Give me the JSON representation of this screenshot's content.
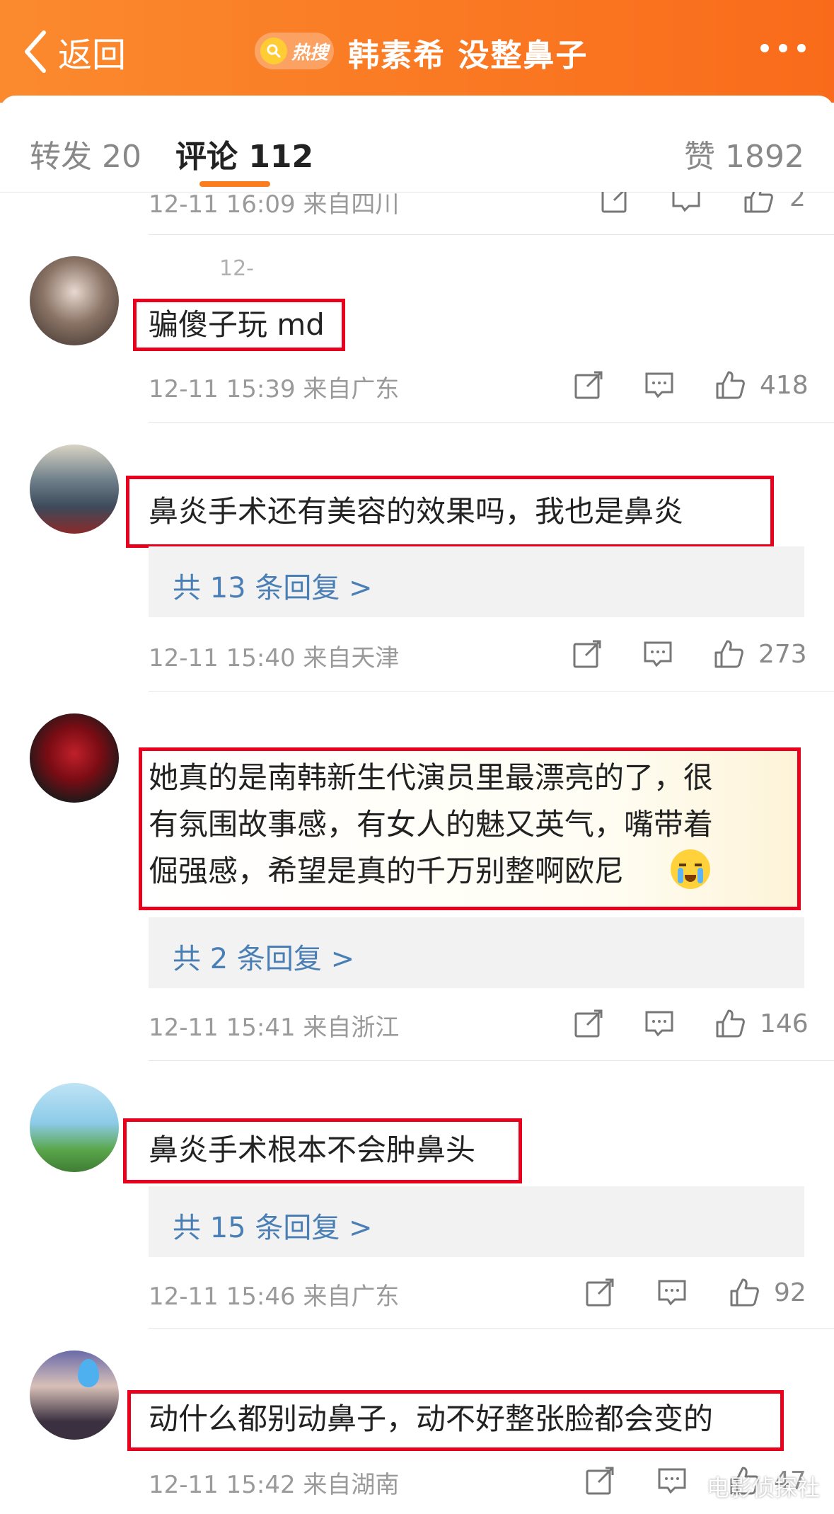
{
  "header": {
    "back_label": "返回",
    "badge_label": "热搜",
    "title": "韩素希 没整鼻子"
  },
  "tabs": {
    "repost": "转发 20",
    "comments": "评论 112",
    "likes": "赞 1892"
  },
  "partial_row": {
    "meta": "12-11 16:09 来自四川",
    "likes": "2"
  },
  "comments": [
    {
      "username": "12-",
      "text": "骗傻子玩 md",
      "time": "12-11 15:39 来自广东",
      "likes": "418"
    },
    {
      "text": "鼻炎手术还有美容的效果吗，我也是鼻炎",
      "replies": "共 13 条回复 >",
      "time": "12-11 15:40 来自天津",
      "likes": "273"
    },
    {
      "text_lines": [
        "她真的是南韩新生代演员里最漂亮的了，很",
        "有氛围故事感，有女人的魅又英气，嘴带着",
        "倔强感，希望是真的千万别整啊欧尼"
      ],
      "replies": "共 2 条回复 >",
      "time": "12-11 15:41 来自浙江",
      "likes": "146"
    },
    {
      "text": "鼻炎手术根本不会肿鼻头",
      "replies": "共 15 条回复 >",
      "time": "12-11 15:46 来自广东",
      "likes": "92"
    },
    {
      "text": "动什么都别动鼻子，动不好整张脸都会变的",
      "time": "12-11 15:42 来自湖南",
      "likes": "47"
    }
  ],
  "watermark": "电影侦探社",
  "colors": {
    "header_gradient_start": "#fb8a2e",
    "header_gradient_end": "#f96b1a",
    "tab_indicator": "#fb7d1d",
    "highlight_box": "#e8001c",
    "reply_link": "#4a7fb5"
  }
}
